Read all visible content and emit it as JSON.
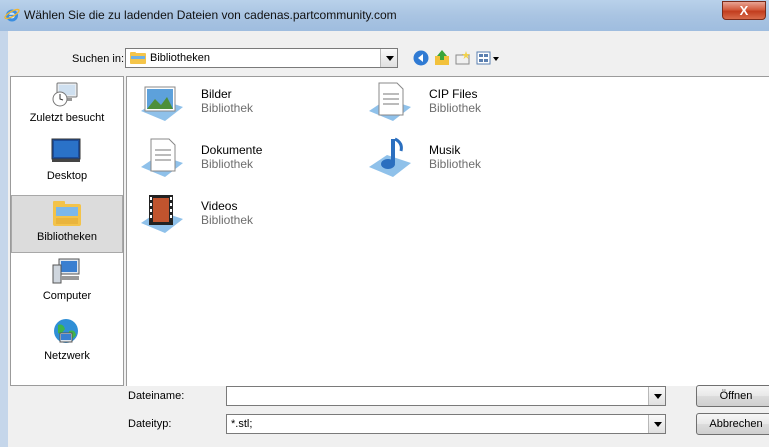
{
  "window": {
    "title": "Wählen Sie die zu ladenden Dateien von cadenas.partcommunity.com",
    "close_symbol": "X"
  },
  "toolbar": {
    "lookin_label": "Suchen in:",
    "lookin_value": "Bibliotheken",
    "icons": [
      "back-icon",
      "up-folder-icon",
      "new-folder-icon",
      "view-menu-icon"
    ]
  },
  "places": [
    {
      "label": "Zuletzt besucht",
      "icon": "recent-places-icon"
    },
    {
      "label": "Desktop",
      "icon": "desktop-icon"
    },
    {
      "label": "Bibliotheken",
      "icon": "libraries-icon",
      "selected": true
    },
    {
      "label": "Computer",
      "icon": "computer-icon"
    },
    {
      "label": "Netzwerk",
      "icon": "network-icon"
    }
  ],
  "files": [
    {
      "name": "Bilder",
      "type": "Bibliothek",
      "icon": "pictures-library-icon"
    },
    {
      "name": "CIP Files",
      "type": "Bibliothek",
      "icon": "documents-library-icon"
    },
    {
      "name": "Dokumente",
      "type": "Bibliothek",
      "icon": "documents-library-icon"
    },
    {
      "name": "Musik",
      "type": "Bibliothek",
      "icon": "music-library-icon"
    },
    {
      "name": "Videos",
      "type": "Bibliothek",
      "icon": "videos-library-icon"
    }
  ],
  "bottom": {
    "filename_label": "Dateiname:",
    "filename_value": "",
    "filetype_label": "Dateityp:",
    "filetype_value": "*.stl;",
    "open_button": "Öffnen",
    "cancel_button": "Abbrechen"
  }
}
